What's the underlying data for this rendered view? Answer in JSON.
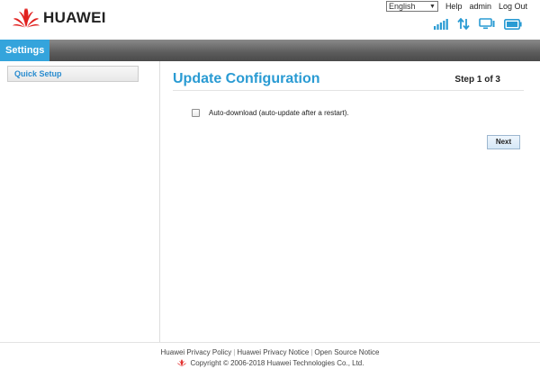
{
  "header": {
    "brand": "HUAWEI",
    "language": "English",
    "help_label": "Help",
    "user_label": "admin",
    "logout_label": "Log Out",
    "icons": [
      "signal-icon",
      "data-transfer-icon",
      "computer-icon",
      "battery-icon"
    ],
    "accent_color": "#34a4dc"
  },
  "nav": {
    "settings_label": "Settings"
  },
  "sidebar": {
    "items": [
      {
        "label": "Quick Setup"
      }
    ]
  },
  "main": {
    "title": "Update Configuration",
    "step": "Step 1 of 3",
    "option_label": "Auto-download (auto-update after a restart).",
    "option_checked": false,
    "next_label": "Next"
  },
  "footer": {
    "links": [
      "Huawei Privacy Policy",
      "Huawei Privacy Notice",
      "Open Source Notice"
    ],
    "copyright": "Copyright © 2006-2018 Huawei Technologies Co., Ltd."
  }
}
